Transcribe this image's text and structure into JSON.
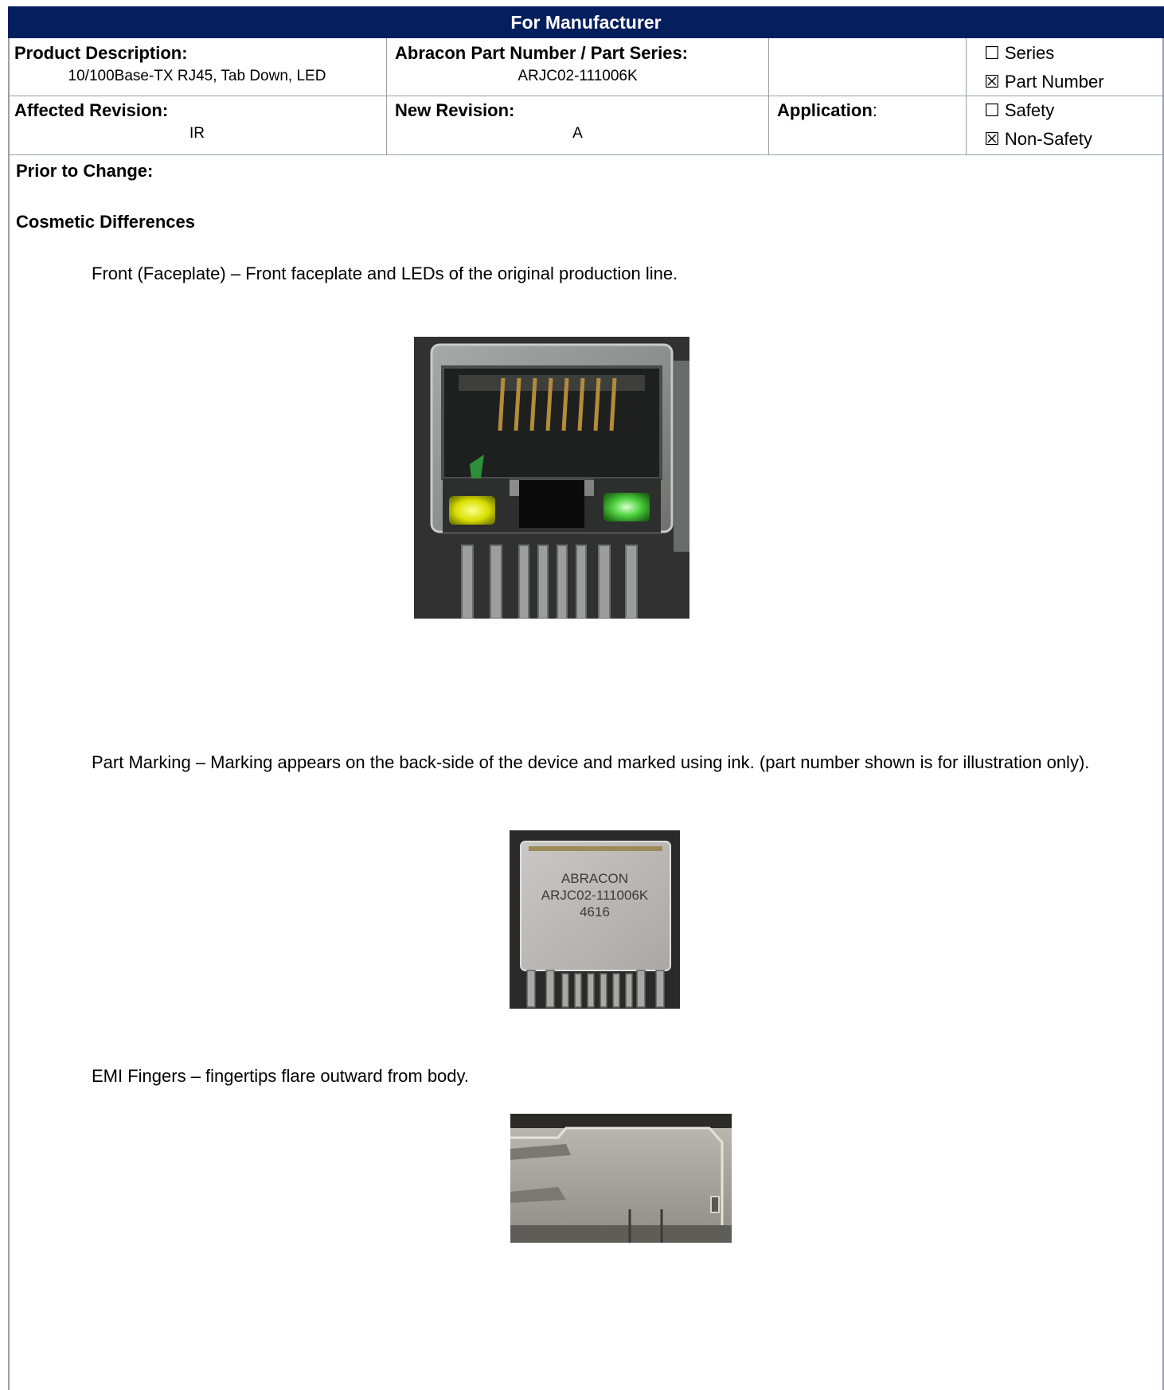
{
  "header": {
    "title": "For Manufacturer"
  },
  "row1": {
    "product_description_label": "Product Description:",
    "product_description_value": "10/100Base-TX RJ45, Tab Down, LED",
    "part_number_label": "Abracon Part Number / Part Series:",
    "part_number_value": "ARJC02-111006K",
    "series_option": "☐ Series",
    "part_number_option": "☒ Part Number"
  },
  "row2": {
    "affected_revision_label": "Affected Revision:",
    "affected_revision_value": "IR",
    "new_revision_label": "New Revision:",
    "new_revision_value": "A",
    "application_label": "Application",
    "application_colon": ":",
    "safety_option": "☐ Safety",
    "non_safety_option": "☒ Non-Safety"
  },
  "body": {
    "prior_to_change": "Prior to Change:",
    "cosmetic_differences": "Cosmetic Differences",
    "front_text": "Front (Faceplate) – Front faceplate and LEDs of the original production line.",
    "marking_text": "Part Marking – Marking appears on the back-side of the device and marked using ink. (part number shown is for illustration only).",
    "emi_text": "EMI Fingers – fingertips flare outward from body."
  },
  "marking_photo": {
    "line1": "ABRACON",
    "line2": "ARJC02-111006K",
    "line3": "4616"
  },
  "colors": {
    "header_bg": "#041e5e",
    "led_yellow": "#e6e600",
    "led_green": "#33cc33"
  }
}
